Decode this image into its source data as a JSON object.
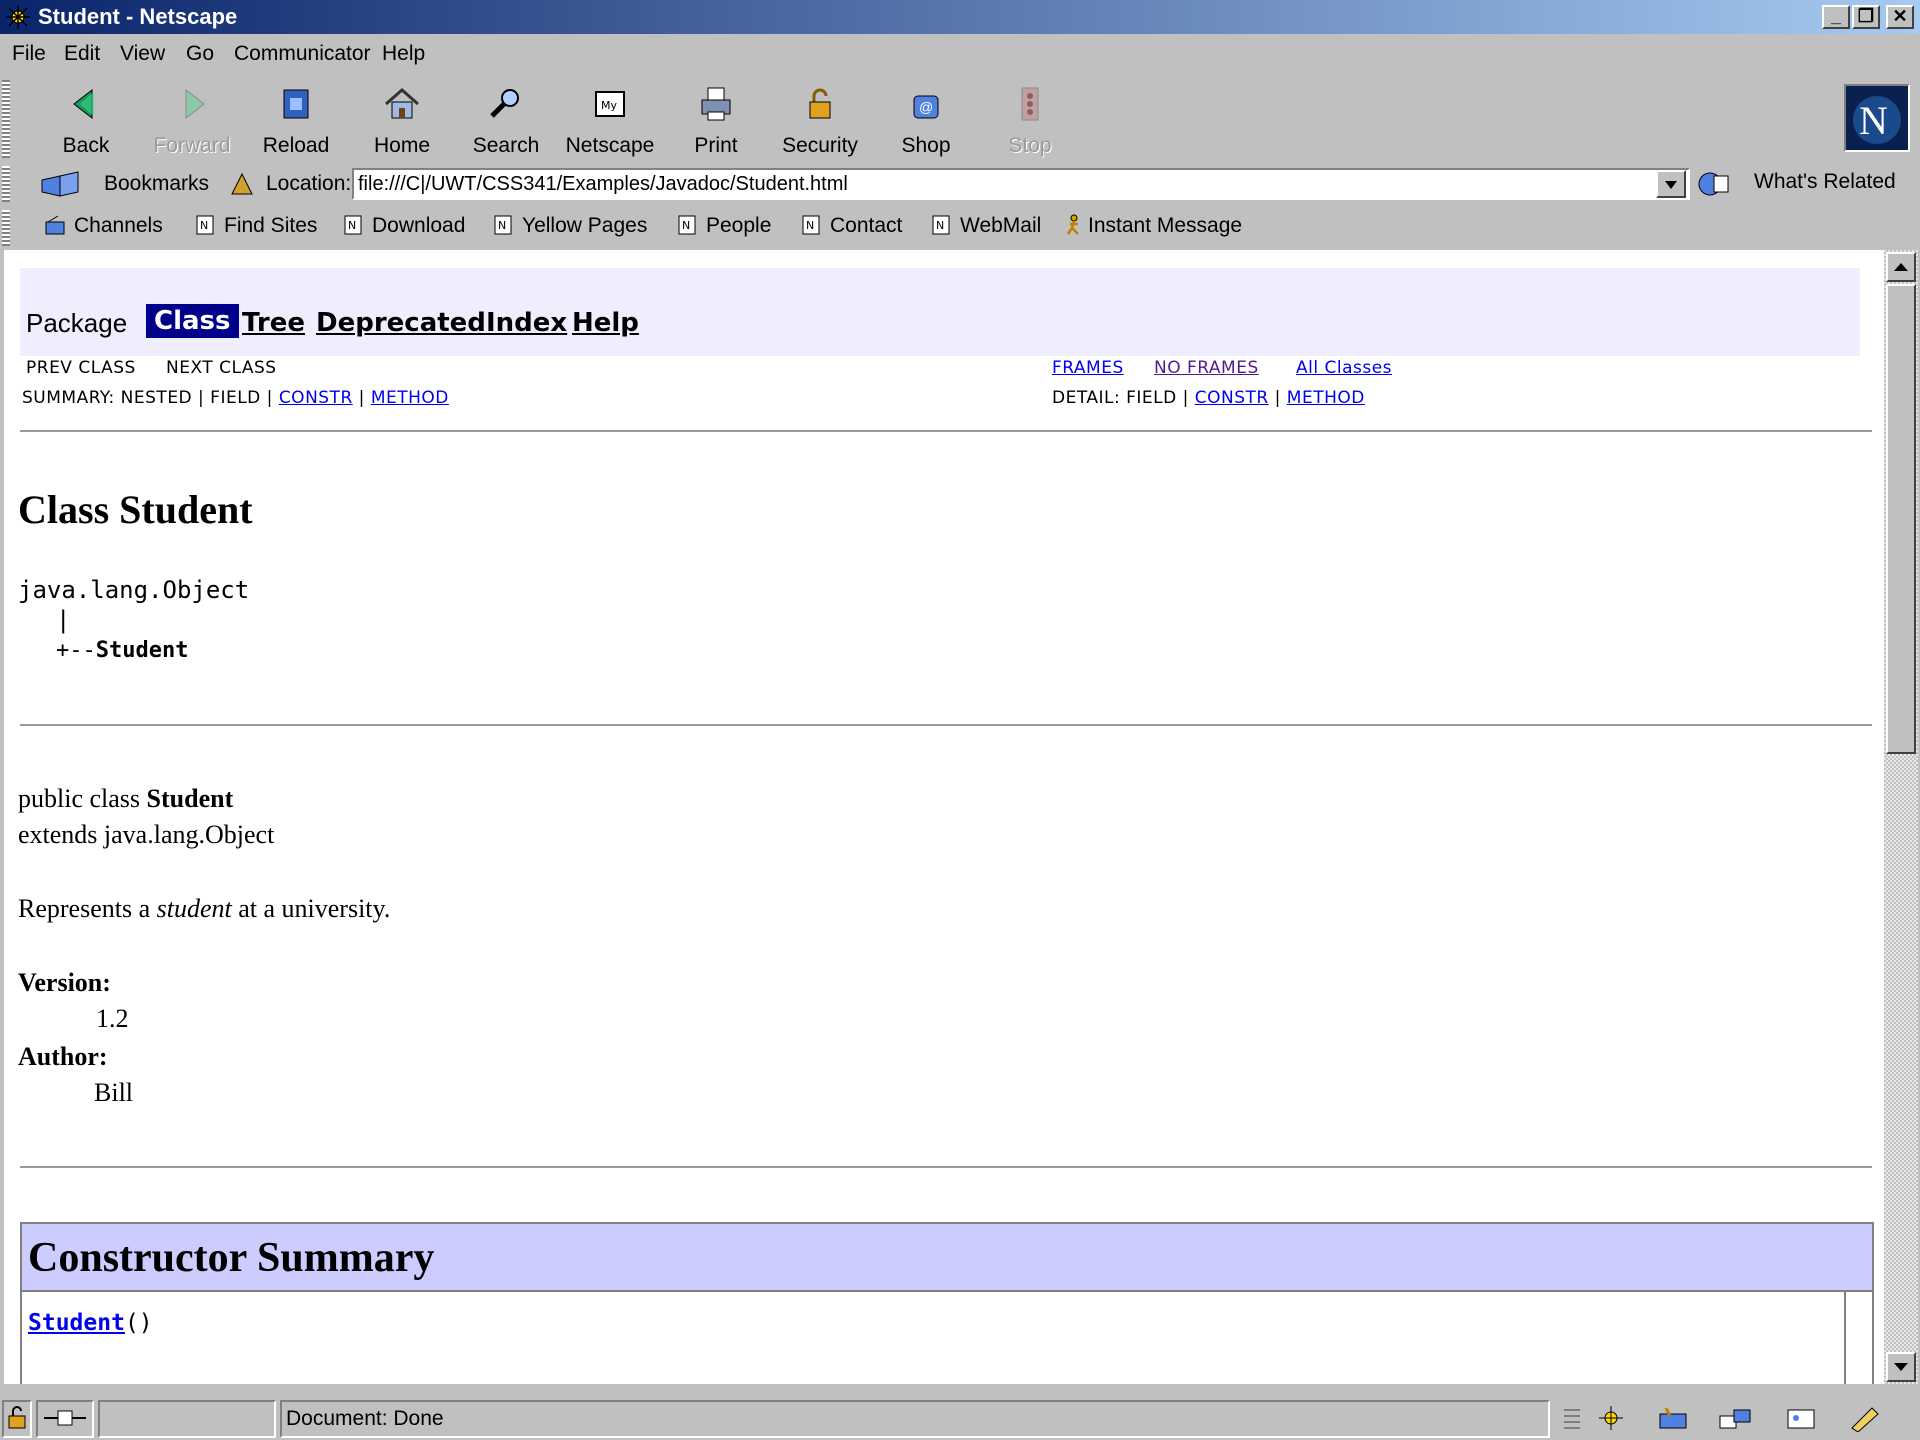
{
  "window": {
    "title": "Student - Netscape"
  },
  "menu": [
    "File",
    "Edit",
    "View",
    "Go",
    "Communicator",
    "Help"
  ],
  "nav_buttons": [
    "Back",
    "Forward",
    "Reload",
    "Home",
    "Search",
    "Netscape",
    "Print",
    "Security",
    "Shop",
    "Stop"
  ],
  "location": {
    "bookmarks_label": "Bookmarks",
    "location_label": "Location:",
    "url": "file:///C|/UWT/CSS341/Examples/Javadoc/Student.html",
    "whats_related": "What's Related"
  },
  "personal_toolbar": [
    "Channels",
    "Find Sites",
    "Download",
    "Yellow Pages",
    "People",
    "Contact",
    "WebMail",
    "Instant Message"
  ],
  "doc": {
    "nav": {
      "package": "Package",
      "class": "Class",
      "tree": "Tree",
      "deprecated": "Deprecated",
      "index": "Index",
      "help": "Help"
    },
    "prev_class": "PREV CLASS",
    "next_class": "NEXT CLASS",
    "frames": "FRAMES",
    "no_frames": "NO FRAMES",
    "all_classes": "All Classes",
    "summary_prefix": "SUMMARY: NESTED | FIELD | ",
    "detail_prefix": "DETAIL: FIELD | ",
    "constr": "CONSTR",
    "method": "METHOD",
    "sep": " | ",
    "class_title": "Class Student",
    "hierarchy": {
      "root": "java.lang.Object",
      "bar": "|",
      "arrow": "+--",
      "child": "Student"
    },
    "decl": {
      "prefix": "public class ",
      "name": "Student",
      "extends": "extends java.lang.Object"
    },
    "desc": {
      "before": "Represents a ",
      "em": "student",
      "after": " at a university."
    },
    "version_label": "Version:",
    "version_value": "1.2",
    "author_label": "Author:",
    "author_value": "Bill",
    "constructor_summary_title": "Constructor Summary",
    "constructor_name": "Student",
    "constructor_parens": "()"
  },
  "status": {
    "text": "Document: Done"
  }
}
